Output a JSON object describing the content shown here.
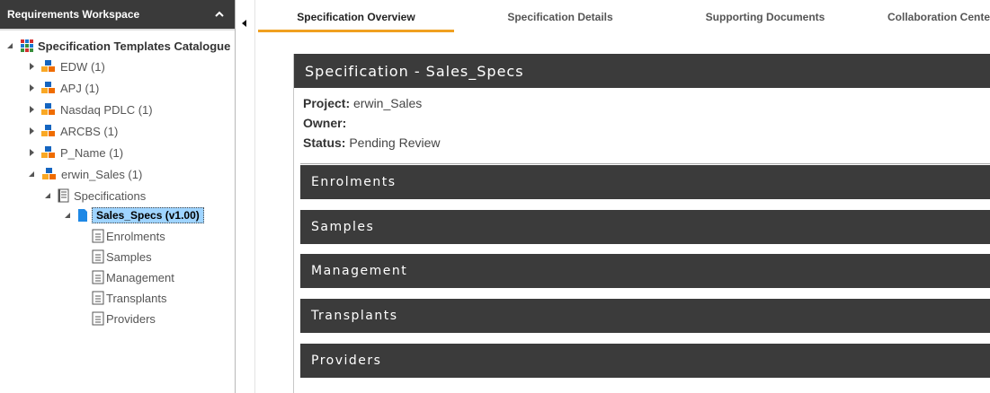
{
  "sidebar": {
    "title": "Requirements Workspace",
    "root": "Specification Templates Catalogue",
    "projects": [
      "EDW (1)",
      "APJ (1)",
      "Nasdaq PDLC (1)",
      "ARCBS (1)",
      "P_Name (1)"
    ],
    "expanded_project": "erwin_Sales (1)",
    "folder": "Specifications",
    "spec": "Sales_Specs (v1.00)",
    "sections": [
      "Enrolments",
      "Samples",
      "Management",
      "Transplants",
      "Providers"
    ]
  },
  "tabs": [
    "Specification Overview",
    "Specification Details",
    "Supporting Documents",
    "Collaboration Cente"
  ],
  "main": {
    "spec_title": "Specification - Sales_Specs",
    "project_label": "Project:",
    "project_value": "erwin_Sales",
    "owner_label": "Owner:",
    "owner_value": "",
    "status_label": "Status:",
    "status_value": "Pending Review",
    "sections": [
      "Enrolments",
      "Samples",
      "Management",
      "Transplants",
      "Providers"
    ]
  },
  "colors": {
    "header_dark": "#3a3a3a",
    "active_tab": "#f0a020",
    "selection": "#9fd4ff"
  }
}
